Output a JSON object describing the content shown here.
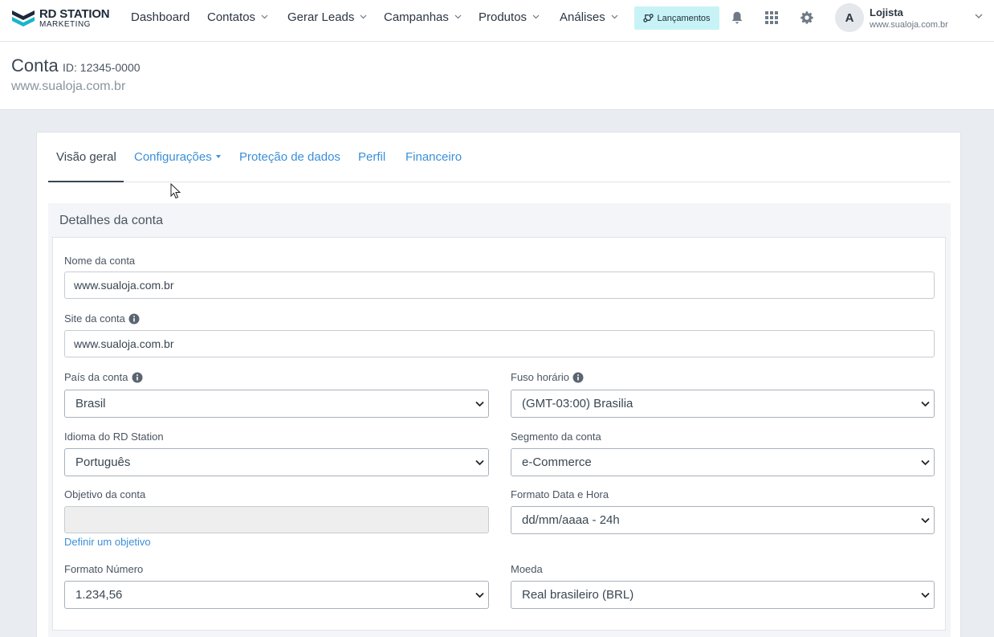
{
  "brand": {
    "line1": "RD STATION",
    "line2": "MARKETING"
  },
  "nav": {
    "items": [
      {
        "label": "Dashboard",
        "dropdown": false
      },
      {
        "label": "Contatos",
        "dropdown": true
      },
      {
        "label": "Gerar Leads",
        "dropdown": true
      },
      {
        "label": "Campanhas",
        "dropdown": true
      },
      {
        "label": "Produtos",
        "dropdown": true
      },
      {
        "label": "Análises",
        "dropdown": true
      }
    ],
    "launch_label": "Lançamentos",
    "icons": [
      "bell-icon",
      "apps-grid-icon",
      "gear-icon"
    ]
  },
  "user": {
    "initial": "A",
    "name": "Lojista",
    "site": "www.sualoja.com.br"
  },
  "page": {
    "title": "Conta",
    "id": "ID: 12345-0000",
    "subtitle": "www.sualoja.com.br"
  },
  "tabs": [
    {
      "label": "Visão geral",
      "active": true
    },
    {
      "label": "Configurações",
      "active": false,
      "dropdown": true
    },
    {
      "label": "Proteção de dados",
      "active": false
    },
    {
      "label": "Perfil",
      "active": false
    },
    {
      "label": "Financeiro",
      "active": false
    }
  ],
  "section": {
    "title": "Detalhes da conta"
  },
  "form": {
    "nome": {
      "label": "Nome da conta",
      "value": "www.sualoja.com.br"
    },
    "site": {
      "label": "Site da conta",
      "value": "www.sualoja.com.br"
    },
    "pais": {
      "label": "País da conta",
      "value": "Brasil"
    },
    "fuso": {
      "label": "Fuso horário",
      "value": "(GMT-03:00) Brasilia"
    },
    "idioma": {
      "label": "Idioma do RD Station",
      "value": "Português"
    },
    "segmento": {
      "label": "Segmento da conta",
      "value": "e-Commerce"
    },
    "objetivo": {
      "label": "Objetivo da conta",
      "value": "",
      "link": "Definir um objetivo"
    },
    "formato_data": {
      "label": "Formato Data e Hora",
      "value": "dd/mm/aaaa - 24h"
    },
    "formato_numero": {
      "label": "Formato Número",
      "value": "1.234,56"
    },
    "moeda": {
      "label": "Moeda",
      "value": "Real brasileiro (BRL)"
    }
  },
  "colors": {
    "accent": "#3b8fd8",
    "launch_bg": "#c8f3f6",
    "text_dark": "#2b3642"
  }
}
